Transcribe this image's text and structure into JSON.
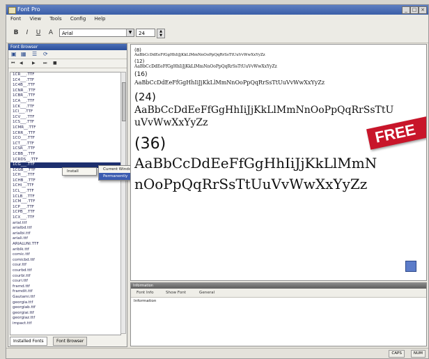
{
  "window": {
    "title": "Font Pro"
  },
  "menu": [
    "Font",
    "View",
    "Tools",
    "Config",
    "Help"
  ],
  "toolbar": {
    "font_value": "Arial",
    "size_value": "24"
  },
  "left_panel": {
    "title": "Font Browser",
    "files": [
      "1CR___.TTF",
      "1C4___.TTF",
      "1C4B__.TTF",
      "1CNR__.TTF",
      "1CBR__.TTF",
      "1CA___.TTF",
      "1CK___.TTF",
      "1CI___.TTF",
      "1CV___.TTF",
      "1CS___.TTF",
      "1CMR__.TTF",
      "1CRR__.TTF",
      "1CO___.TTF",
      "1CT___.TTF",
      "1CSR__.TTF",
      "1CBB__.TTF",
      "1CRDS__.TTF",
      "1CG___.TTF",
      "1CGB__.TTF",
      "1CH___.TTF",
      "1CHB__.TTF",
      "1CHI__.TTF",
      "1CL___.TTF",
      "1CLB__.TTF",
      "1CM___.TTF",
      "1CP___.TTF",
      "1CPB__.TTF",
      "1CX___.TTF",
      "arial.ttf",
      "arialbd.ttf",
      "arialbi.ttf",
      "ariali.ttf",
      "ARIALUNI.TTF",
      "ariblk.ttf",
      "comic.ttf",
      "comicbd.ttf",
      "cour.ttf",
      "courbd.ttf",
      "courbi.ttf",
      "couri.ttf",
      "framd.ttf",
      "framdit.ttf",
      "Gautami.ttf",
      "georgia.ttf",
      "georgiab.ttf",
      "georgiai.ttf",
      "georgiaz.ttf",
      "impact.ttf"
    ],
    "selected_index": 17,
    "tabs": [
      "Installed Fonts",
      "Font Browser"
    ]
  },
  "context_menu": {
    "parent": [
      "Install"
    ],
    "sub": [
      "Current Windows Session",
      "Permanently"
    ],
    "highlight": "Permanently"
  },
  "preview": {
    "lines": [
      {
        "text": "(8)",
        "size": 7
      },
      {
        "text": "AaBbCcDdEeFfGgHhIiJjKkLlMmNnOoPpQqRrSsTtUuVvWwXxYyZz",
        "size": 5.5
      },
      {
        "text": "(12)",
        "size": 7
      },
      {
        "text": "AaBbCcDdEeFfGgHhIiJjKkLlMmNnOoPpQqRrSsTtUuVvWwXxYyZz",
        "size": 6
      },
      {
        "text": "(16)",
        "size": 9
      },
      {
        "text": "AaBbCcDdEeFfGgHhIiJjKkLlMmNnOoPpQqRrSsTtUuVvWwXxYyZz",
        "size": 8
      },
      {
        "text": "(24)",
        "size": 15
      },
      {
        "text": "AaBbCcDdEeFfGgHhIiJjKkLlMmNnOoPpQqRrSsTtU",
        "size": 14
      },
      {
        "text": "uVvWwXxYyZz",
        "size": 14
      },
      {
        "text": "(36)",
        "size": 22
      },
      {
        "text": "AaBbCcDdEeFfGgHhIiJjKkLlMmN",
        "size": 20
      },
      {
        "text": "nOoPpQqRrSsTtUuVvWwXxYyZz",
        "size": 20
      }
    ],
    "banner": "FREE"
  },
  "info_panel": {
    "title": "Information",
    "tools": [
      "Font Info",
      "Show Font",
      "General"
    ],
    "text": "Information"
  },
  "status": [
    "CAPS",
    "NUM"
  ]
}
